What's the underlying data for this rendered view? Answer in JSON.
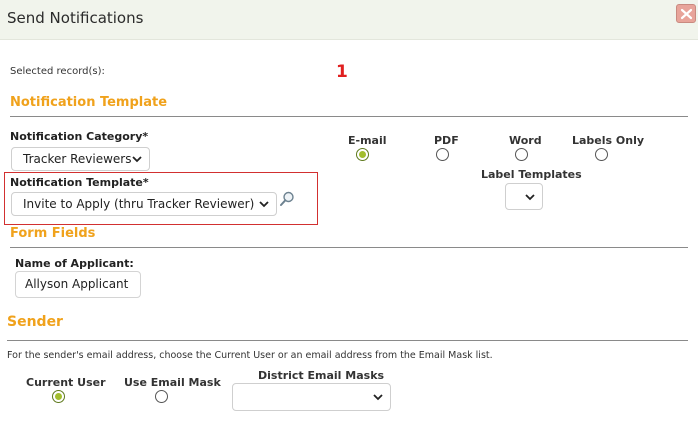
{
  "window": {
    "title": "Send Notifications",
    "close_icon": "close-icon"
  },
  "selected_records": {
    "label": "Selected record(s):",
    "count": "1"
  },
  "notification_template_section": {
    "title": "Notification Template",
    "category_label": "Notification Category*",
    "category_value": "Tracker Reviewers",
    "template_label": "Notification Template*",
    "template_value": "Invite to Apply (thru Tracker Reviewer)",
    "search_icon": "magnifier-icon"
  },
  "output_options": [
    {
      "label": "E-mail",
      "checked": true
    },
    {
      "label": "PDF",
      "checked": false
    },
    {
      "label": "Word",
      "checked": false
    },
    {
      "label": "Labels Only",
      "checked": false
    }
  ],
  "label_templates": {
    "label": "Label Templates",
    "value": ""
  },
  "form_fields_section": {
    "title": "Form Fields",
    "name_label": "Name of Applicant:",
    "name_value": "Allyson Applicant"
  },
  "sender_section": {
    "title": "Sender",
    "description": "For the sender's email address, choose the Current User or an email address from the Email Mask list.",
    "options": [
      {
        "label": "Current User",
        "checked": true
      },
      {
        "label": "Use Email Mask",
        "checked": false
      }
    ],
    "masks_label": "District Email Masks",
    "masks_value": ""
  },
  "colors": {
    "section_title": "#f0a21c",
    "record_count": "#e02020",
    "radio_fill": "#a2be2e",
    "highlight": "#d23030"
  }
}
